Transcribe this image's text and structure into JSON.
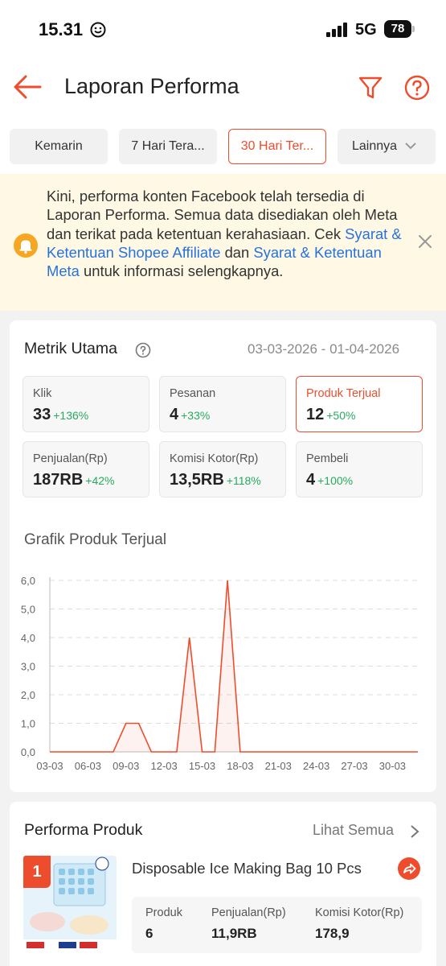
{
  "status": {
    "time": "15.31",
    "network": "5G",
    "battery": "78"
  },
  "header": {
    "title": "Laporan Performa"
  },
  "tabs": [
    {
      "label": "Kemarin"
    },
    {
      "label": "7 Hari Tera..."
    },
    {
      "label": "30 Hari Ter..."
    },
    {
      "label": "Lainnya"
    }
  ],
  "notice": {
    "part1": "Kini, performa konten Facebook telah tersedia di Laporan Performa. Semua data disediakan oleh Meta dan terikat pada ketentuan kerahasiaan. Cek ",
    "link1": "Syarat & Ketentuan Shopee Affiliate",
    "part2": " dan ",
    "link2": "Syarat & Ketentuan Meta",
    "part3": " untuk informasi selengkapnya."
  },
  "metrics": {
    "title": "Metrik Utama",
    "date_range": "03-03-2026 - 01-04-2026",
    "items": [
      {
        "label": "Klik",
        "value": "33",
        "change": "+136%"
      },
      {
        "label": "Pesanan",
        "value": "4",
        "change": "+33%"
      },
      {
        "label": "Produk Terjual",
        "value": "12",
        "change": "+50%"
      },
      {
        "label": "Penjualan(Rp)",
        "value": "187RB",
        "change": "+42%"
      },
      {
        "label": "Komisi Kotor(Rp)",
        "value": "13,5RB",
        "change": "+118%"
      },
      {
        "label": "Pembeli",
        "value": "4",
        "change": "+100%"
      }
    ]
  },
  "chart_data": {
    "type": "area",
    "title": "Grafik Produk Terjual",
    "x_ticks": [
      "03-03",
      "06-03",
      "09-03",
      "12-03",
      "15-03",
      "18-03",
      "21-03",
      "24-03",
      "27-03",
      "30-03"
    ],
    "y_ticks": [
      "0,0",
      "1,0",
      "2,0",
      "3,0",
      "4,0",
      "5,0",
      "6,0"
    ],
    "ylim": [
      0,
      6
    ],
    "x": [
      "03-03",
      "04-03",
      "05-03",
      "06-03",
      "07-03",
      "08-03",
      "09-03",
      "10-03",
      "11-03",
      "12-03",
      "13-03",
      "14-03",
      "15-03",
      "16-03",
      "17-03",
      "18-03",
      "19-03",
      "20-03",
      "21-03",
      "22-03",
      "23-03",
      "24-03",
      "25-03",
      "26-03",
      "27-03",
      "28-03",
      "29-03",
      "30-03",
      "31-03",
      "01-04"
    ],
    "series": [
      {
        "values": [
          0,
          0,
          0,
          0,
          0,
          0,
          1,
          1,
          0,
          0,
          0,
          4,
          0,
          0,
          6,
          0,
          0,
          0,
          0,
          0,
          0,
          0,
          0,
          0,
          0,
          0,
          0,
          0,
          0,
          0
        ]
      }
    ],
    "grid": "horizontal dashed",
    "colors": {
      "line": "#ee4d2d"
    }
  },
  "products": {
    "title": "Performa Produk",
    "see_all": "Lihat Semua",
    "items": [
      {
        "rank": "1",
        "name": "Disposable Ice Making Bag 10 Pcs",
        "stats": [
          {
            "label": "Produk",
            "value": "6"
          },
          {
            "label": "Penjualan(Rp)",
            "value": "11,9RB"
          },
          {
            "label": "Komisi Kotor(Rp)",
            "value": "178,9"
          }
        ]
      }
    ]
  },
  "colors": {
    "accent": "#ee4d2d",
    "link": "#2673dd",
    "positive": "#26aa5e",
    "notice_bg": "#fff8e4"
  }
}
